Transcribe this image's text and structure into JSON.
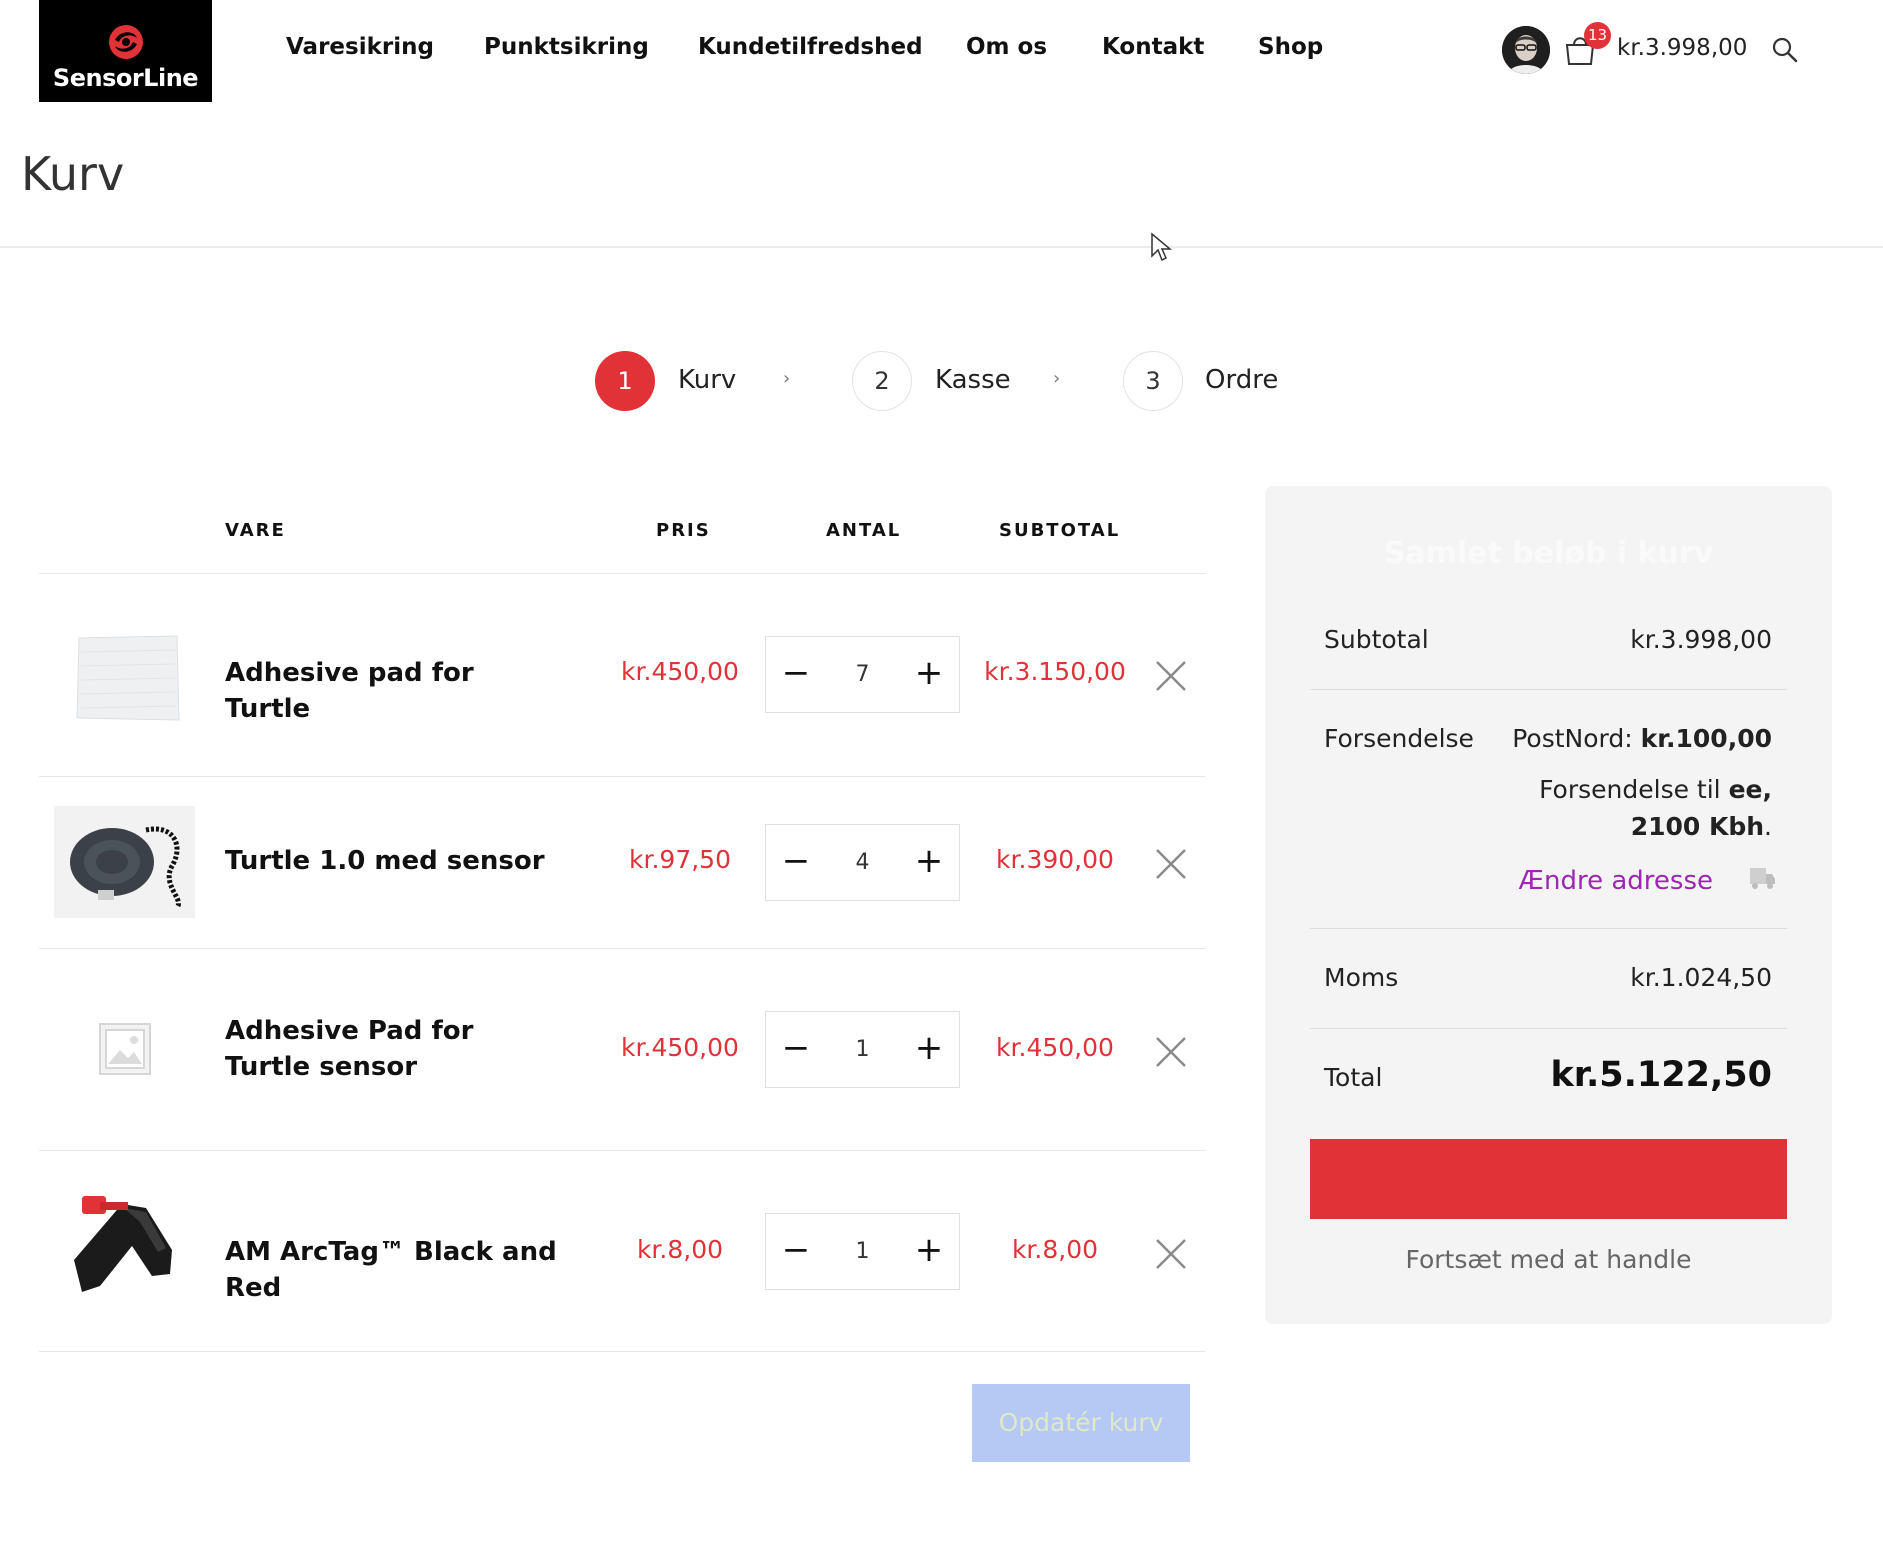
{
  "brand": {
    "name": "SensorLine",
    "accent": "#e03237"
  },
  "nav": [
    "Varesikring",
    "Punktsikring",
    "Kundetilfredshed",
    "Om os",
    "Kontakt",
    "Shop"
  ],
  "header": {
    "cart_count": "13",
    "cart_total": "kr.3.998,00"
  },
  "page": {
    "title": "Kurv"
  },
  "steps": [
    {
      "num": "1",
      "label": "Kurv",
      "active": true
    },
    {
      "num": "2",
      "label": "Kasse",
      "active": false
    },
    {
      "num": "3",
      "label": "Ordre",
      "active": false
    }
  ],
  "table": {
    "headers": {
      "product": "VARE",
      "price": "PRIS",
      "qty": "ANTAL",
      "subtotal": "SUBTOTAL"
    },
    "rows": [
      {
        "name": "Adhesive pad for Turtle",
        "price": "kr.450,00",
        "qty": "7",
        "subtotal": "kr.3.150,00"
      },
      {
        "name": "Turtle 1.0 med sensor",
        "price": "kr.97,50",
        "qty": "4",
        "subtotal": "kr.390,00"
      },
      {
        "name": "Adhesive Pad for Turtle sensor",
        "price": "kr.450,00",
        "qty": "1",
        "subtotal": "kr.450,00"
      },
      {
        "name": "AM ArcTag™ Black and Red",
        "price": "kr.8,00",
        "qty": "1",
        "subtotal": "kr.8,00"
      }
    ],
    "qty_minus": "−",
    "qty_plus": "+",
    "update_label": "Opdatér kurv"
  },
  "totals": {
    "title": "Samlet beløb i kurv",
    "subtotal_label": "Subtotal",
    "subtotal_value": "kr.3.998,00",
    "shipping_label": "Forsendelse",
    "shipping_method": "PostNord:",
    "shipping_price": "kr.100,00",
    "shipping_to_prefix": "Forsendelse til",
    "shipping_to_city": "ee,",
    "shipping_to_zip": "2100 Kbh",
    "shipping_to_suffix": ".",
    "change_address": "Ændre adresse",
    "tax_label": "Moms",
    "tax_value": "kr.1.024,50",
    "total_label": "Total",
    "total_value": "kr.5.122,50",
    "continue_label": "Fortsæt med at handle"
  }
}
